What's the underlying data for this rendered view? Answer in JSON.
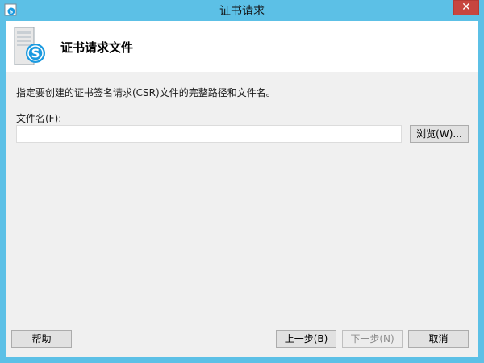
{
  "window": {
    "title": "证书请求",
    "close_glyph": "✕",
    "accent_color": "#5cc0e6",
    "close_color": "#c7453f",
    "icon": "skype-app-icon"
  },
  "header": {
    "title": "证书请求文件",
    "icon": "skype-server-icon"
  },
  "content": {
    "description": "指定要创建的证书签名请求(CSR)文件的完整路径和文件名。",
    "file_label": "文件名(F):",
    "file_value": "",
    "browse_label": "浏览(W)..."
  },
  "footer": {
    "help_label": "帮助",
    "back_label": "上一步(B)",
    "next_label": "下一步(N)",
    "cancel_label": "取消"
  }
}
